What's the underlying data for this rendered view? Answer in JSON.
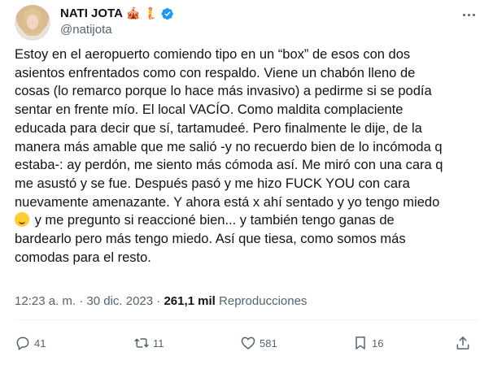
{
  "user": {
    "display_name": "NATI JOTA",
    "name_emojis": [
      "🎪",
      "🧜"
    ],
    "handle": "@natijota",
    "verified": true
  },
  "tweet": {
    "lines": [
      "Estoy en el aeropuerto comiendo tipo en un “box” de esos con dos",
      "asientos enfrentados como con respaldo. Viene un chabón lleno de",
      "cosas (lo remarco porque lo hace más invasivo) a pedirme si se podía",
      "sentar en frente mío. El local VACÍO. Como maldita complaciente",
      "educada para decir que sí, tartamudeé. Pero finalmente le dije, de la",
      "manera más amable que me salió -y no recuerdo bien de lo incómoda q",
      "estaba-: ay perdón, me siento más cómoda así. Me miró con una cara q",
      "me asustó y se fue. Después pasó y me hizo FUCK YOU con cara",
      "nuevamente amenazante. Y ahora está x ahí sentado y yo tengo miedo",
      " y me pregunto si reaccioné bien... y también tengo ganas de",
      "bardearlo pero más tengo miedo. Así que tiesa, como somos más",
      "comodas para el resto."
    ],
    "time": "12:23 a. m.",
    "separator": "·",
    "date": "30 dic. 2023",
    "views_count": "261,1 mil",
    "views_label": "Reproducciones"
  },
  "actions": {
    "reply_count": "41",
    "retweet_count": "11",
    "like_count": "581",
    "bookmark_count": "16"
  },
  "colors": {
    "text": "#0f1419",
    "muted": "#536471",
    "verified": "#1d9bf0",
    "divider": "#eff3f4"
  }
}
